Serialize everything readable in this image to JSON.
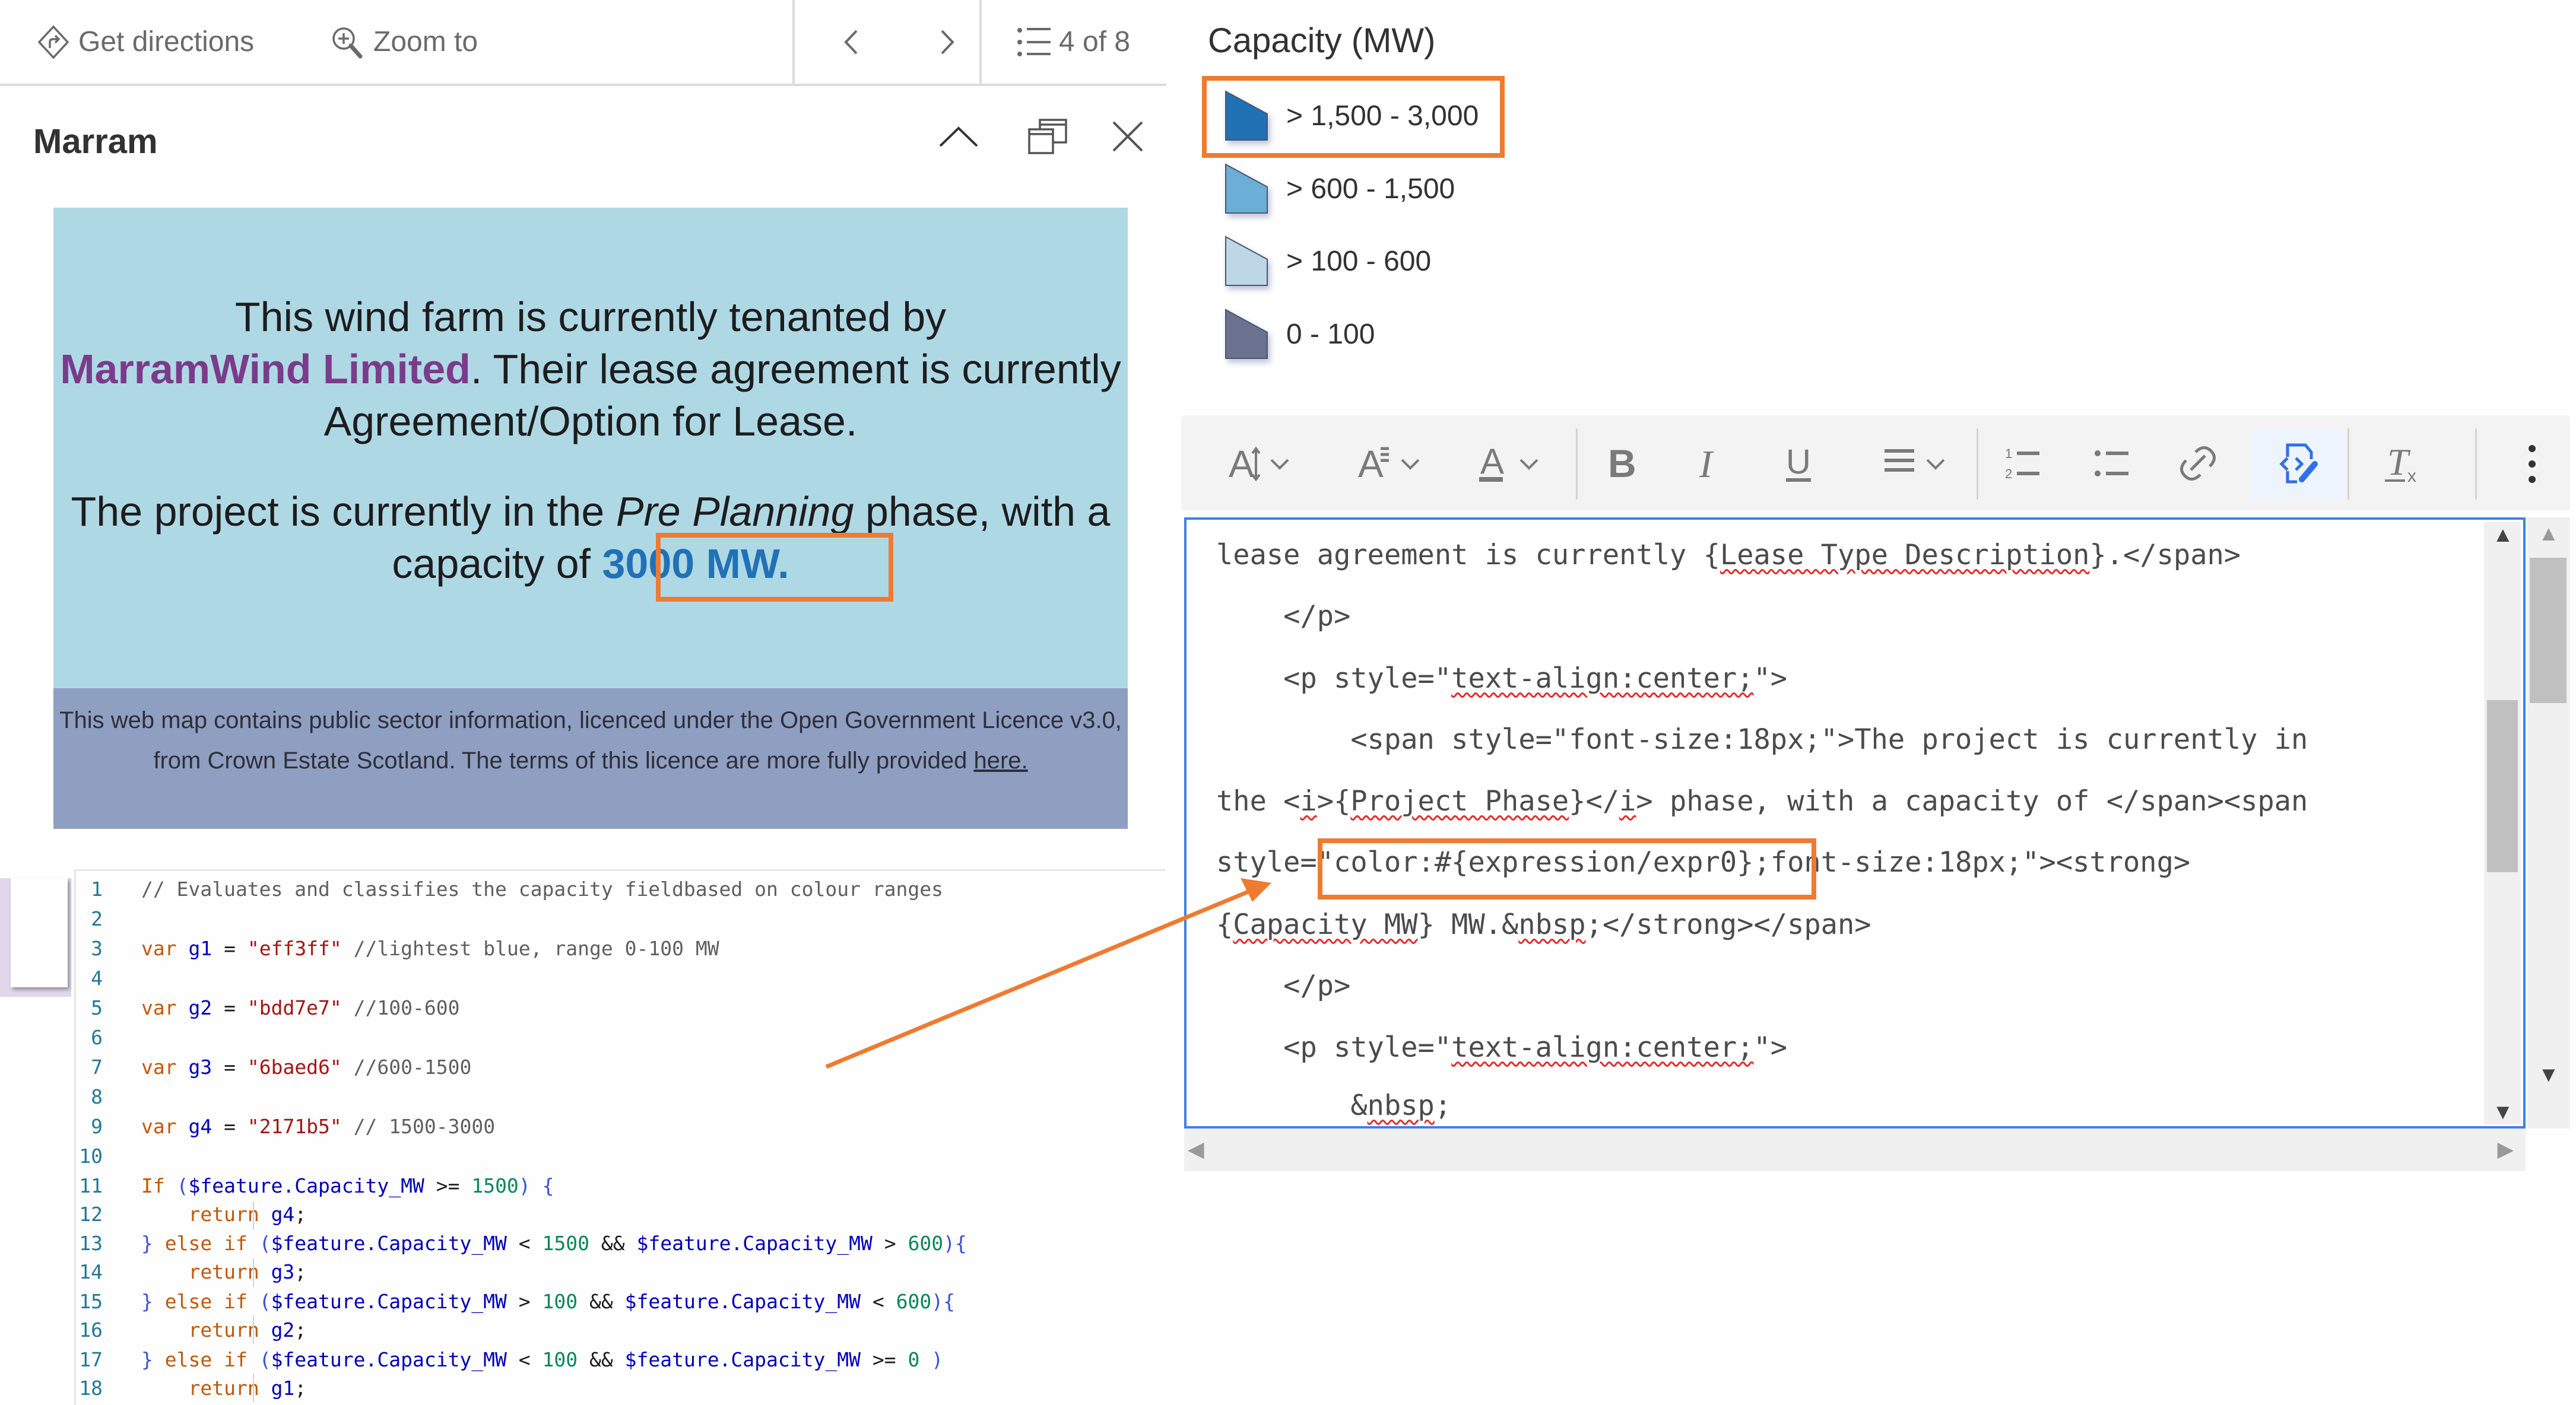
{
  "popup": {
    "actions": {
      "get_directions": "Get directions",
      "zoom_to": "Zoom to"
    },
    "navigation": {
      "feature_count": "4 of 8"
    },
    "title": "Marram",
    "content": {
      "para1_prefix": "This wind farm is currently tenanted by",
      "tenant_name": "MarramWind Limited",
      "para1_mid": ". Their lease agreement is currently Agreement/Option for Lease.",
      "para2_prefix": "The project is currently in the ",
      "project_phase": "Pre Planning",
      "para2_mid": " phase, with a capacity of ",
      "capacity_value": "3000 MW.",
      "capacity_color": "#2171b5",
      "tenant_color": "#7b3b8a"
    },
    "licence": {
      "text": "This web map contains public sector information, licenced under the Open Government Licence v3.0, from Crown Estate Scotland. The terms of this licence are more fully provided ",
      "link_text": "here."
    }
  },
  "legend": {
    "title": "Capacity (MW)",
    "items": [
      {
        "label": "> 1,500 - 3,000",
        "color": "#2171b5",
        "highlighted": true
      },
      {
        "label": "> 600 - 1,500",
        "color": "#6baed6",
        "highlighted": false
      },
      {
        "label": "> 100 - 600",
        "color": "#bdd7e7",
        "highlighted": false
      },
      {
        "label": "0 - 100",
        "color": "#6a7290",
        "highlighted": false
      }
    ]
  },
  "arcade_code": {
    "lines": [
      {
        "n": "1",
        "tokens": [
          [
            "cmt",
            "// Evaluates and classifies the capacity fieldbased on colour ranges"
          ]
        ]
      },
      {
        "n": "2",
        "tokens": []
      },
      {
        "n": "3",
        "tokens": [
          [
            "kw",
            "var "
          ],
          [
            "var",
            "g1"
          ],
          [
            "op",
            " = "
          ],
          [
            "str",
            "\"eff3ff\""
          ],
          [
            "cmt",
            " //lightest blue, range 0-100 MW"
          ]
        ]
      },
      {
        "n": "4",
        "tokens": []
      },
      {
        "n": "5",
        "tokens": [
          [
            "kw",
            "var "
          ],
          [
            "var",
            "g2"
          ],
          [
            "op",
            " = "
          ],
          [
            "str",
            "\"bdd7e7\""
          ],
          [
            "cmt",
            " //100-600"
          ]
        ]
      },
      {
        "n": "6",
        "tokens": []
      },
      {
        "n": "7",
        "tokens": [
          [
            "kw",
            "var "
          ],
          [
            "var",
            "g3"
          ],
          [
            "op",
            " = "
          ],
          [
            "str",
            "\"6baed6\""
          ],
          [
            "cmt",
            " //600-1500"
          ]
        ]
      },
      {
        "n": "8",
        "tokens": []
      },
      {
        "n": "9",
        "tokens": [
          [
            "kw",
            "var "
          ],
          [
            "var",
            "g4"
          ],
          [
            "op",
            " = "
          ],
          [
            "str",
            "\"2171b5\""
          ],
          [
            "cmt",
            " // 1500-3000"
          ]
        ]
      },
      {
        "n": "10",
        "tokens": []
      },
      {
        "n": "11",
        "tokens": [
          [
            "kw",
            "If "
          ],
          [
            "par",
            "("
          ],
          [
            "var",
            "$feature.Capacity_MW"
          ],
          [
            "op",
            " >= "
          ],
          [
            "num",
            "1500"
          ],
          [
            "par",
            ")"
          ],
          [
            "op",
            " "
          ],
          [
            "par",
            "{"
          ]
        ]
      },
      {
        "n": "12",
        "tokens": [
          [
            "op",
            "    "
          ],
          [
            "kw",
            "return "
          ],
          [
            "var",
            "g4"
          ],
          [
            "op",
            ";"
          ]
        ]
      },
      {
        "n": "13",
        "tokens": [
          [
            "par",
            "}"
          ],
          [
            "kw",
            " else if "
          ],
          [
            "par",
            "("
          ],
          [
            "var",
            "$feature.Capacity_MW"
          ],
          [
            "op",
            " < "
          ],
          [
            "num",
            "1500"
          ],
          [
            "op",
            " && "
          ],
          [
            "var",
            "$feature.Capacity_MW"
          ],
          [
            "op",
            " > "
          ],
          [
            "num",
            "600"
          ],
          [
            "par",
            ")"
          ],
          [
            "par",
            "{"
          ]
        ]
      },
      {
        "n": "14",
        "tokens": [
          [
            "op",
            "    "
          ],
          [
            "kw",
            "return "
          ],
          [
            "var",
            "g3"
          ],
          [
            "op",
            ";"
          ]
        ]
      },
      {
        "n": "15",
        "tokens": [
          [
            "par",
            "}"
          ],
          [
            "kw",
            " else if "
          ],
          [
            "par",
            "("
          ],
          [
            "var",
            "$feature.Capacity_MW"
          ],
          [
            "op",
            " > "
          ],
          [
            "num",
            "100"
          ],
          [
            "op",
            " && "
          ],
          [
            "var",
            "$feature.Capacity_MW"
          ],
          [
            "op",
            " < "
          ],
          [
            "num",
            "600"
          ],
          [
            "par",
            ")"
          ],
          [
            "par",
            "{"
          ]
        ]
      },
      {
        "n": "16",
        "tokens": [
          [
            "op",
            "    "
          ],
          [
            "kw",
            "return "
          ],
          [
            "var",
            "g2"
          ],
          [
            "op",
            ";"
          ]
        ]
      },
      {
        "n": "17",
        "tokens": [
          [
            "par",
            "}"
          ],
          [
            "kw",
            " else if "
          ],
          [
            "par",
            "("
          ],
          [
            "var",
            "$feature.Capacity_MW"
          ],
          [
            "op",
            " < "
          ],
          [
            "num",
            "100"
          ],
          [
            "op",
            " && "
          ],
          [
            "var",
            "$feature.Capacity_MW"
          ],
          [
            "op",
            " >= "
          ],
          [
            "num",
            "0"
          ],
          [
            "op",
            " "
          ],
          [
            "par",
            ")"
          ]
        ]
      },
      {
        "n": "18",
        "tokens": [
          [
            "op",
            "    "
          ],
          [
            "kw",
            "return "
          ],
          [
            "var",
            "g1"
          ],
          [
            "op",
            ";"
          ]
        ]
      }
    ]
  },
  "rich_text_editor": {
    "toolbar": [
      {
        "id": "font-size",
        "icon": "font-size-icon",
        "dropdown": true
      },
      {
        "id": "font-family",
        "icon": "font-family-icon",
        "dropdown": true
      },
      {
        "id": "font-color",
        "icon": "font-color-icon",
        "dropdown": true
      },
      {
        "id": "bold",
        "icon": "bold-icon",
        "glyph": "B"
      },
      {
        "id": "italic",
        "icon": "italic-icon",
        "glyph": "I"
      },
      {
        "id": "underline",
        "icon": "underline-icon",
        "glyph": "U"
      },
      {
        "id": "align",
        "icon": "align-icon",
        "dropdown": true
      },
      {
        "id": "numbered-list",
        "icon": "numbered-list-icon"
      },
      {
        "id": "bulleted-list",
        "icon": "bulleted-list-icon"
      },
      {
        "id": "link",
        "icon": "link-icon"
      },
      {
        "id": "source",
        "icon": "source-edit-icon",
        "active": true
      },
      {
        "id": "remove-format",
        "icon": "remove-format-icon"
      },
      {
        "id": "more",
        "icon": "more-vertical-icon"
      }
    ],
    "source_lines": [
      [
        [
          "t",
          "lease agreement is currently {"
        ],
        [
          "sq",
          "Lease Type Description"
        ],
        [
          "t",
          "}.</span>"
        ]
      ],
      [
        [
          "t",
          "    </p>"
        ]
      ],
      [
        [
          "t",
          "    <p style=\""
        ],
        [
          "sq",
          "text-align:center;"
        ],
        [
          "t",
          "\">"
        ]
      ],
      [
        [
          "t",
          "        <span style=\"font-size:18px;\">The project is currently in"
        ]
      ],
      [
        [
          "t",
          "the <"
        ],
        [
          "sq",
          "i"
        ],
        [
          "t",
          ">{"
        ],
        [
          "sq",
          "Project Phase"
        ],
        [
          "t",
          "}</"
        ],
        [
          "sq",
          "i"
        ],
        [
          "t",
          "> phase, with a capacity of </span><span"
        ]
      ],
      [
        [
          "t",
          "style=\"color:#{expression/expr0};font-size:18px;\"><strong>"
        ]
      ],
      [
        [
          "t",
          "{"
        ],
        [
          "sq",
          "Capacity MW"
        ],
        [
          "t",
          "} MW.&"
        ],
        [
          "sq",
          "nbsp"
        ],
        [
          "t",
          ";</strong></span>"
        ]
      ],
      [
        [
          "t",
          "    </p>"
        ]
      ],
      [
        [
          "t",
          "    <p style=\""
        ],
        [
          "sq",
          "text-align:center;"
        ],
        [
          "t",
          "\">"
        ]
      ],
      [
        [
          "t",
          "        &"
        ],
        [
          "sq",
          "nbsp"
        ],
        [
          "t",
          ";"
        ]
      ]
    ],
    "accent_color": "#3f7fe8"
  },
  "annotations": {
    "highlight_color": "#ee7b30"
  }
}
